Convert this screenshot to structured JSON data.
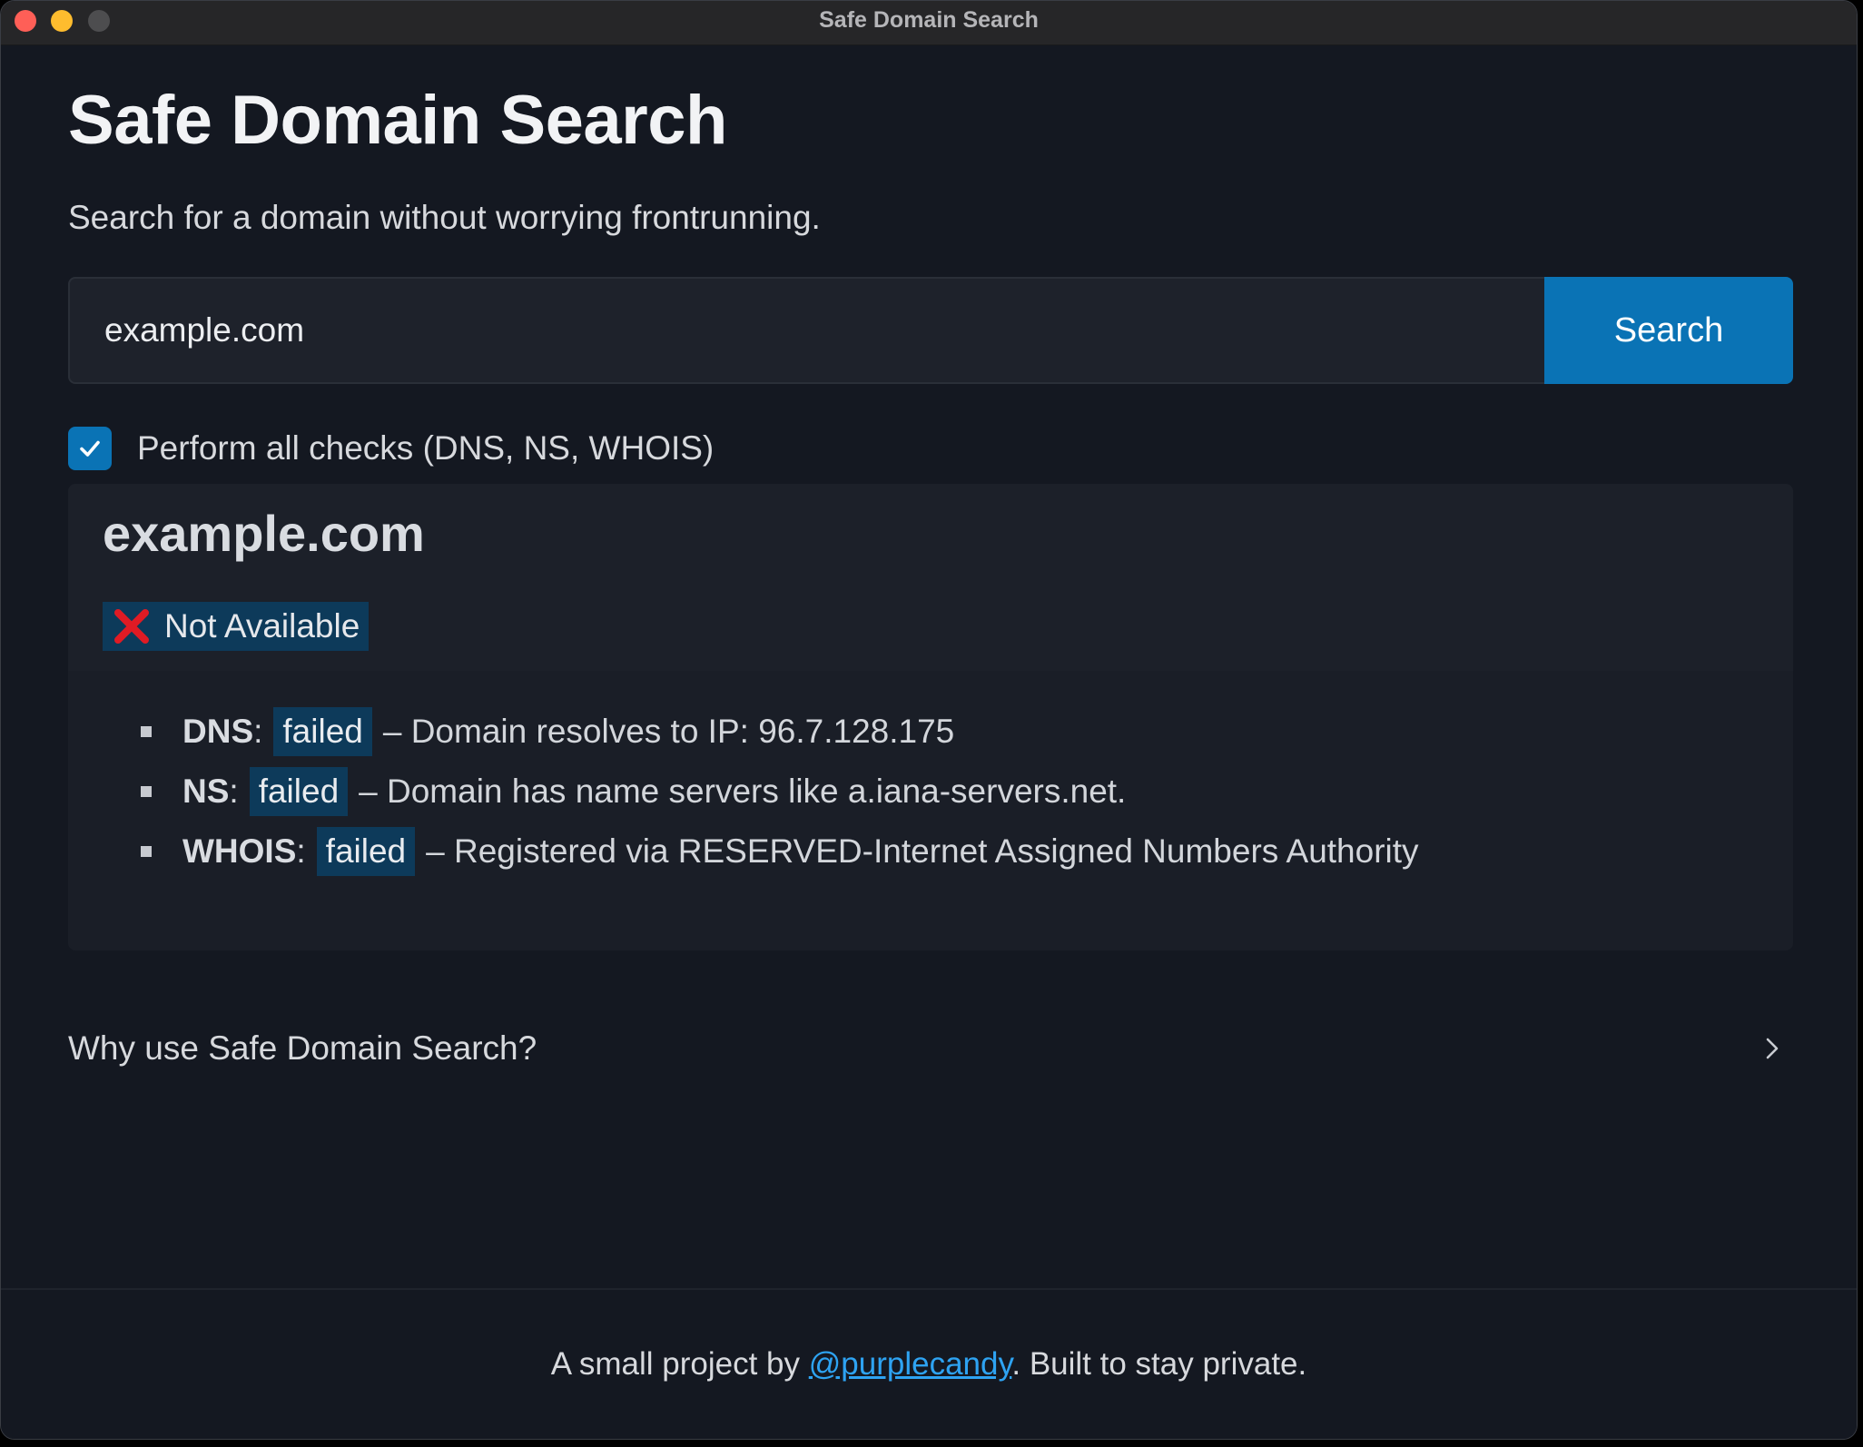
{
  "window": {
    "title": "Safe Domain Search"
  },
  "header": {
    "title": "Safe Domain Search",
    "subtitle": "Search for a domain without worrying frontrunning."
  },
  "search": {
    "value": "example.com",
    "button_label": "Search"
  },
  "options": {
    "all_checks_label": "Perform all checks (DNS, NS, WHOIS)",
    "all_checks_checked": true
  },
  "result": {
    "domain": "example.com",
    "status_icon": "red-x-icon",
    "status_label": "Not Available",
    "checks": [
      {
        "name": "DNS",
        "status": "failed",
        "detail": "– Domain resolves to IP: 96.7.128.175"
      },
      {
        "name": "NS",
        "status": "failed",
        "detail": "– Domain has name servers like a.iana-servers.net."
      },
      {
        "name": "WHOIS",
        "status": "failed",
        "detail": "– Registered via RESERVED-Internet Assigned Numbers Authority"
      }
    ]
  },
  "faq": {
    "label": "Why use Safe Domain Search?",
    "icon": "chevron-right-icon"
  },
  "footer": {
    "prefix": "A small project by ",
    "link_text": "@purplecandy",
    "suffix": ". Built to stay private."
  },
  "colors": {
    "background": "#141821",
    "accent": "#0a73b5",
    "badge": "#0d3a5a",
    "link": "#2ea3f2",
    "error": "#e01b24"
  }
}
